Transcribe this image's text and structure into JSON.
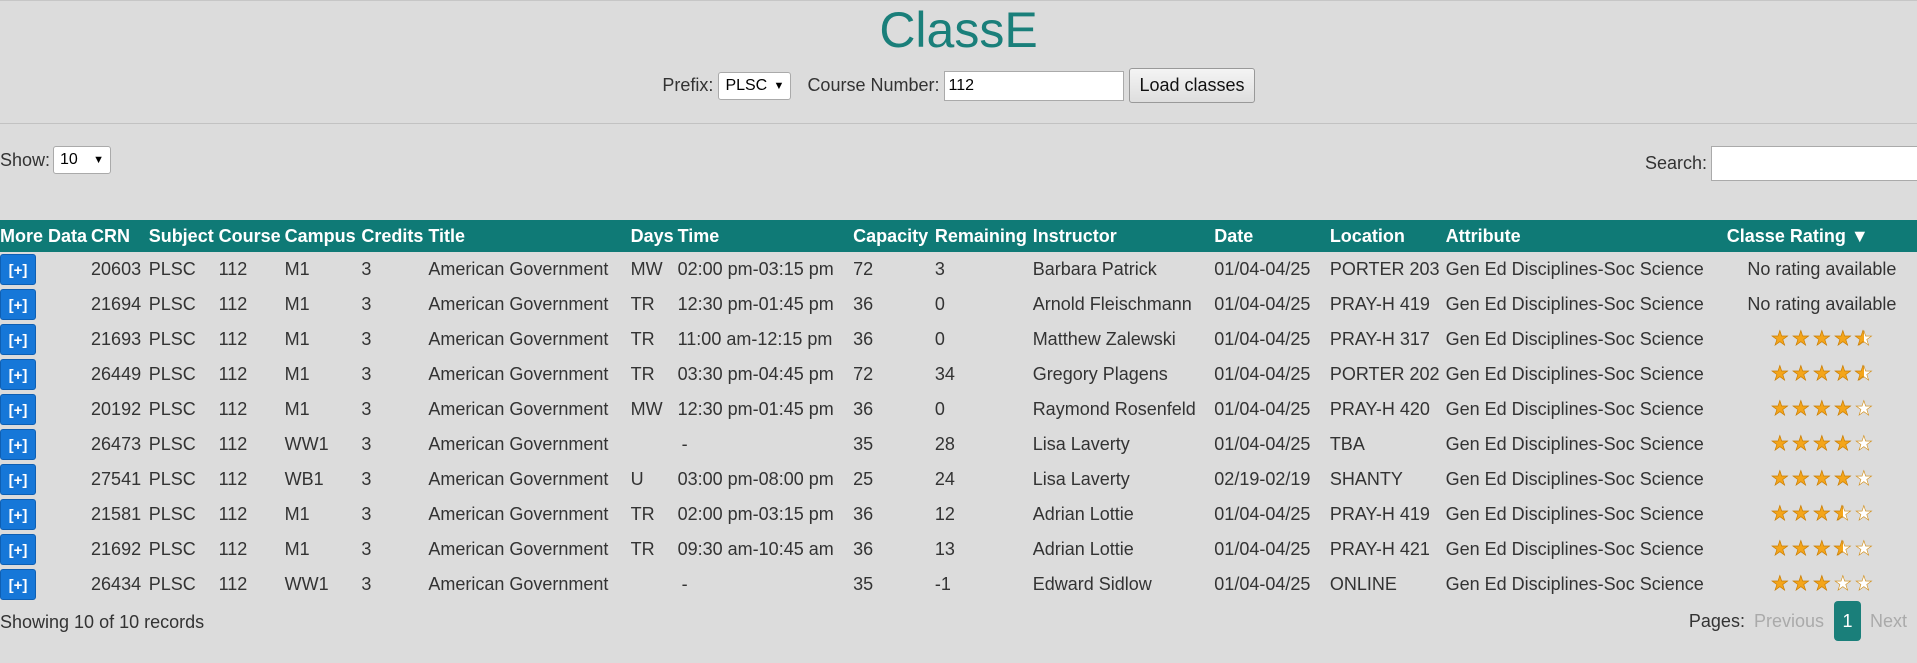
{
  "app": {
    "title": "ClassE"
  },
  "controls": {
    "prefix_label": "Prefix:",
    "prefix_value": "PLSC",
    "course_label": "Course Number:",
    "course_value": "112",
    "load_label": "Load classes"
  },
  "show": {
    "label": "Show:",
    "value": "10"
  },
  "search": {
    "label": "Search:",
    "value": ""
  },
  "table": {
    "headers": [
      "More Data",
      "CRN",
      "Subject",
      "Course",
      "Campus",
      "Credits",
      "Title",
      "Days",
      "Time",
      "Capacity",
      "Remaining",
      "Instructor",
      "Date",
      "Location",
      "Attribute",
      "Classe Rating ▼"
    ],
    "more_label": "[+]",
    "rows": [
      {
        "crn": "20603",
        "subject": "PLSC",
        "course": "112",
        "campus": "M1",
        "credits": "3",
        "title": "American Government",
        "days": "MW",
        "time": "02:00 pm-03:15 pm",
        "capacity": "72",
        "remaining": "3",
        "instructor": "Barbara Patrick",
        "date": "01/04-04/25",
        "location": "PORTER 203",
        "attribute": "Gen Ed Disciplines-Soc Science",
        "rating_text": "No rating available",
        "rating": null
      },
      {
        "crn": "21694",
        "subject": "PLSC",
        "course": "112",
        "campus": "M1",
        "credits": "3",
        "title": "American Government",
        "days": "TR",
        "time": "12:30 pm-01:45 pm",
        "capacity": "36",
        "remaining": "0",
        "instructor": "Arnold Fleischmann",
        "date": "01/04-04/25",
        "location": "PRAY-H 419",
        "attribute": "Gen Ed Disciplines-Soc Science",
        "rating_text": "No rating available",
        "rating": null
      },
      {
        "crn": "21693",
        "subject": "PLSC",
        "course": "112",
        "campus": "M1",
        "credits": "3",
        "title": "American Government",
        "days": "TR",
        "time": "11:00 am-12:15 pm",
        "capacity": "36",
        "remaining": "0",
        "instructor": "Matthew Zalewski",
        "date": "01/04-04/25",
        "location": "PRAY-H 317",
        "attribute": "Gen Ed Disciplines-Soc Science",
        "rating_text": "",
        "rating": 4.5
      },
      {
        "crn": "26449",
        "subject": "PLSC",
        "course": "112",
        "campus": "M1",
        "credits": "3",
        "title": "American Government",
        "days": "TR",
        "time": "03:30 pm-04:45 pm",
        "capacity": "72",
        "remaining": "34",
        "instructor": "Gregory Plagens",
        "date": "01/04-04/25",
        "location": "PORTER 202",
        "attribute": "Gen Ed Disciplines-Soc Science",
        "rating_text": "",
        "rating": 4.5
      },
      {
        "crn": "20192",
        "subject": "PLSC",
        "course": "112",
        "campus": "M1",
        "credits": "3",
        "title": "American Government",
        "days": "MW",
        "time": "12:30 pm-01:45 pm",
        "capacity": "36",
        "remaining": "0",
        "instructor": "Raymond Rosenfeld",
        "date": "01/04-04/25",
        "location": "PRAY-H 420",
        "attribute": "Gen Ed Disciplines-Soc Science",
        "rating_text": "",
        "rating": 4.0
      },
      {
        "crn": "26473",
        "subject": "PLSC",
        "course": "112",
        "campus": "WW1",
        "credits": "3",
        "title": "American Government",
        "days": "",
        "time": "-",
        "capacity": "35",
        "remaining": "28",
        "instructor": "Lisa Laverty",
        "date": "01/04-04/25",
        "location": "TBA",
        "attribute": "Gen Ed Disciplines-Soc Science",
        "rating_text": "",
        "rating": 4.0
      },
      {
        "crn": "27541",
        "subject": "PLSC",
        "course": "112",
        "campus": "WB1",
        "credits": "3",
        "title": "American Government",
        "days": "U",
        "time": "03:00 pm-08:00 pm",
        "capacity": "25",
        "remaining": "24",
        "instructor": "Lisa Laverty",
        "date": "02/19-02/19",
        "location": "SHANTY",
        "attribute": "Gen Ed Disciplines-Soc Science",
        "rating_text": "",
        "rating": 4.0
      },
      {
        "crn": "21581",
        "subject": "PLSC",
        "course": "112",
        "campus": "M1",
        "credits": "3",
        "title": "American Government",
        "days": "TR",
        "time": "02:00 pm-03:15 pm",
        "capacity": "36",
        "remaining": "12",
        "instructor": "Adrian Lottie",
        "date": "01/04-04/25",
        "location": "PRAY-H 419",
        "attribute": "Gen Ed Disciplines-Soc Science",
        "rating_text": "",
        "rating": 3.5
      },
      {
        "crn": "21692",
        "subject": "PLSC",
        "course": "112",
        "campus": "M1",
        "credits": "3",
        "title": "American Government",
        "days": "TR",
        "time": "09:30 am-10:45 am",
        "capacity": "36",
        "remaining": "13",
        "instructor": "Adrian Lottie",
        "date": "01/04-04/25",
        "location": "PRAY-H 421",
        "attribute": "Gen Ed Disciplines-Soc Science",
        "rating_text": "",
        "rating": 3.5
      },
      {
        "crn": "26434",
        "subject": "PLSC",
        "course": "112",
        "campus": "WW1",
        "credits": "3",
        "title": "American Government",
        "days": "",
        "time": "-",
        "capacity": "35",
        "remaining": "-1",
        "instructor": "Edward Sidlow",
        "date": "01/04-04/25",
        "location": "ONLINE",
        "attribute": "Gen Ed Disciplines-Soc Science",
        "rating_text": "",
        "rating": 3.0
      }
    ]
  },
  "footer": {
    "showing": "Showing 10 of 10 records",
    "pages_label": "Pages:",
    "previous": "Previous",
    "current_page": "1",
    "next": "Next"
  },
  "colors": {
    "accent": "#1a7f7a",
    "header_bg": "#0f7a76",
    "button_blue": "#1677d8",
    "star": "#f4a51a"
  }
}
